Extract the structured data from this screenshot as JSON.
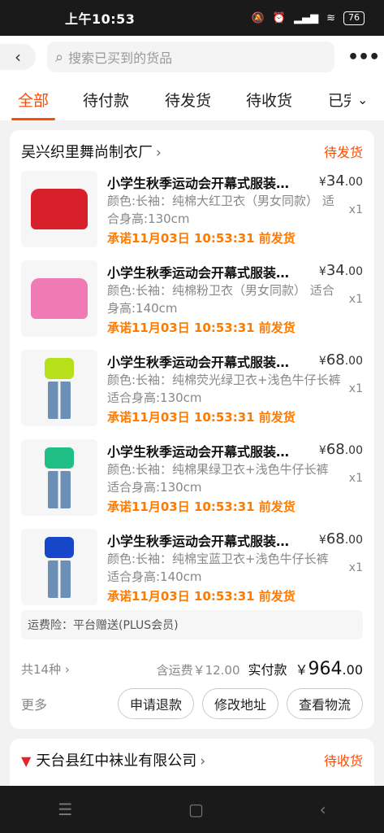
{
  "status_bar": {
    "time": "上午10:53",
    "battery": "76"
  },
  "search": {
    "placeholder": "搜索已买到的货品"
  },
  "tabs": [
    "全部",
    "待付款",
    "待发货",
    "待收货",
    "已完成"
  ],
  "orders": [
    {
      "shop": "吴兴织里舞尚制衣厂",
      "status": "待发货",
      "items": [
        {
          "title": "小学生秋季运动会开幕式服装开幕式服装",
          "price_symbol": "¥",
          "price_int": "34",
          "price_dec": ".00",
          "spec": "颜色:长袖：纯棉大红卫衣（男女同款） 适合身高:130cm",
          "qty": "x1",
          "promise": "承诺11月03日 10:53:31 前发货",
          "color": "#d8202a"
        },
        {
          "title": "小学生秋季运动会开幕式服装开幕式服装",
          "price_symbol": "¥",
          "price_int": "34",
          "price_dec": ".00",
          "spec": "颜色:长袖：纯棉粉卫衣（男女同款） 适合身高:140cm",
          "qty": "x1",
          "promise": "承诺11月03日 10:53:31 前发货",
          "color": "#f07ab4"
        },
        {
          "title": "小学生秋季运动会开幕式服装开幕式服装",
          "price_symbol": "¥",
          "price_int": "68",
          "price_dec": ".00",
          "spec": "颜色:长袖：纯棉荧光绿卫衣+浅色牛仔长裤 适合身高:130cm",
          "qty": "x1",
          "promise": "承诺11月03日 10:53:31 前发货",
          "color": "#b6e01a"
        },
        {
          "title": "小学生秋季运动会开幕式服装开幕式服装",
          "price_symbol": "¥",
          "price_int": "68",
          "price_dec": ".00",
          "spec": "颜色:长袖：纯棉果绿卫衣+浅色牛仔长裤 适合身高:130cm",
          "qty": "x1",
          "promise": "承诺11月03日 10:53:31 前发货",
          "color": "#1fbf86"
        },
        {
          "title": "小学生秋季运动会开幕式服装开幕式服装",
          "price_symbol": "¥",
          "price_int": "68",
          "price_dec": ".00",
          "spec": "颜色:长袖：纯棉宝蓝卫衣+浅色牛仔长裤 适合身高:140cm",
          "qty": "x1",
          "promise": "承诺11月03日 10:53:31 前发货",
          "color": "#1746c8"
        }
      ],
      "insurance": "运费险：平台赠送(PLUS会员)",
      "count": "共14种",
      "shipping": "含运费￥12.00",
      "paid_label": "实付款",
      "paid_symbol": "￥",
      "paid_int": "964",
      "paid_dec": ".00",
      "more": "更多",
      "buttons": [
        "申请退款",
        "修改地址",
        "查看物流"
      ]
    },
    {
      "shop": "天台县红中袜业有限公司",
      "status": "待收货"
    }
  ],
  "colors": {
    "accent": "#ff4b00",
    "promise": "#ff7a00"
  }
}
